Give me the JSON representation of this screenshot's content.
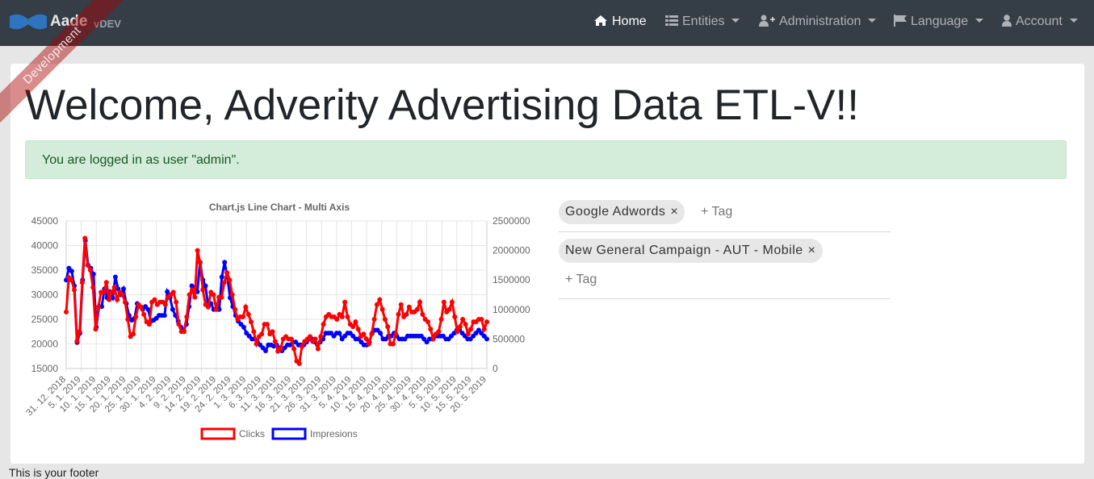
{
  "navbar": {
    "brand": "Aade",
    "version": "vDEV",
    "ribbon": "Development",
    "items": [
      {
        "label": "Home",
        "icon": "home-icon",
        "active": true
      },
      {
        "label": "Entities",
        "icon": "list-icon",
        "dropdown": true
      },
      {
        "label": "Administration",
        "icon": "user-plus-icon",
        "dropdown": true
      },
      {
        "label": "Language",
        "icon": "flag-icon",
        "dropdown": true
      },
      {
        "label": "Account",
        "icon": "user-icon",
        "dropdown": true
      }
    ]
  },
  "main": {
    "title": "Welcome, Adverity Advertising Data ETL-V!!",
    "alert": "You are logged in as user \"admin\".",
    "footer": "This is your footer"
  },
  "tags": {
    "rows": [
      {
        "chips": [
          "Google Adwords"
        ],
        "add_label": "+ Tag"
      },
      {
        "chips": [
          "New General Campaign - AUT - Mobile"
        ],
        "add_label": "+ Tag"
      }
    ],
    "remove_glyph": "×"
  },
  "chart_data": {
    "type": "line",
    "title": "Chart.js Line Chart - Multi Axis",
    "x_ticks": [
      "31. 12. 2018",
      "5. 1. 2019",
      "10. 1. 2019",
      "15. 1. 2019",
      "20. 1. 2019",
      "25. 1. 2019",
      "30. 1. 2019",
      "4. 2. 2019",
      "9. 2. 2019",
      "14. 2. 2019",
      "19. 2. 2019",
      "24. 2. 2019",
      "1. 3. 2019",
      "6. 3. 2019",
      "11. 3. 2019",
      "16. 3. 2019",
      "21. 3. 2019",
      "26. 3. 2019",
      "31. 3. 2019",
      "5. 4. 2019",
      "10. 4. 2019",
      "15. 4. 2019",
      "20. 4. 2019",
      "25. 4. 2019",
      "30. 4. 2019",
      "5. 5. 2019",
      "10. 5. 2019",
      "15. 5. 2019",
      "20. 5. 2019"
    ],
    "y_left": {
      "min": 15000,
      "max": 45000,
      "ticks": [
        15000,
        20000,
        25000,
        30000,
        35000,
        40000,
        45000
      ]
    },
    "y_right": {
      "min": 0,
      "max": 2500000,
      "ticks": [
        0,
        500000,
        1000000,
        1500000,
        2000000,
        2500000
      ]
    },
    "grid": true,
    "legend_position": "bottom",
    "series": [
      {
        "name": "Clicks",
        "axis": "left",
        "color": "#ff0000",
        "values": [
          26500,
          33500,
          33000,
          31000,
          20500,
          22500,
          32500,
          41500,
          36000,
          35000,
          31500,
          23000,
          27500,
          30500,
          30500,
          32500,
          29000,
          30500,
          31500,
          29000,
          30500,
          30000,
          28500,
          25000,
          21500,
          22000,
          25500,
          28000,
          27500,
          26000,
          24500,
          24000,
          28500,
          29000,
          28000,
          28500,
          28500,
          28000,
          29500,
          30000,
          30500,
          28500,
          24000,
          22500,
          22500,
          25500,
          30000,
          31000,
          29500,
          39000,
          36500,
          31000,
          28000,
          27500,
          30500,
          30000,
          27000,
          29500,
          29500,
          32500,
          34500,
          33000,
          30000,
          27000,
          25000,
          25500,
          25500,
          27500,
          26000,
          24500,
          22500,
          20000,
          21500,
          22000,
          24000,
          24000,
          22000,
          22500,
          20500,
          18500,
          19000,
          21000,
          21500,
          21000,
          21000,
          19000,
          16500,
          16000,
          19500,
          20500,
          21000,
          21500,
          20500,
          21000,
          19000,
          21500,
          24000,
          25500,
          26000,
          25500,
          25500,
          25000,
          26000,
          25500,
          28500,
          25500,
          24000,
          23500,
          24500,
          23000,
          21500,
          22000,
          21000,
          20000,
          22000,
          25000,
          28000,
          29000,
          27000,
          25000,
          23500,
          20000,
          20000,
          22000,
          26000,
          28000,
          25500,
          26000,
          27500,
          26500,
          26500,
          27000,
          28500,
          26000,
          25000,
          24500,
          23000,
          21000,
          22000,
          22500,
          25000,
          28500,
          26500,
          27000,
          28500,
          25500,
          22500,
          23500,
          25000,
          24000,
          22000,
          23000,
          24500,
          24500,
          25000,
          25000,
          23000,
          24500
        ],
        "points": "markers"
      },
      {
        "name": "Impresions",
        "axis": "right",
        "color": "#0000ff",
        "values": [
          1500000,
          1700000,
          1650000,
          1400000,
          440000,
          600000,
          1500000,
          2170000,
          1750000,
          1700000,
          1600000,
          700000,
          1050000,
          1050000,
          1350000,
          1200000,
          1300000,
          1200000,
          1550000,
          1350000,
          1250000,
          1350000,
          1100000,
          900000,
          820000,
          850000,
          1100000,
          1050000,
          1000000,
          1050000,
          1000000,
          800000,
          820000,
          850000,
          900000,
          900000,
          900000,
          1300000,
          1200000,
          1000000,
          900000,
          800000,
          700000,
          650000,
          750000,
          1050000,
          1400000,
          1350000,
          1300000,
          1800000,
          1500000,
          1400000,
          1050000,
          1100000,
          1000000,
          1000000,
          1000000,
          1550000,
          1800000,
          1550000,
          1200000,
          1050000,
          900000,
          800000,
          750000,
          700000,
          600000,
          550000,
          500000,
          500000,
          450000,
          400000,
          350000,
          300000,
          400000,
          400000,
          380000,
          400000,
          350000,
          300000,
          350000,
          400000,
          400000,
          450000,
          450000,
          400000,
          400000,
          400000,
          450000,
          500000,
          500000,
          450000,
          400000,
          450000,
          500000,
          600000,
          600000,
          600000,
          550000,
          600000,
          600000,
          500000,
          550000,
          600000,
          600000,
          550000,
          500000,
          500000,
          450000,
          400000,
          400000,
          450000,
          600000,
          650000,
          650000,
          600000,
          500000,
          500000,
          550000,
          550000,
          600000,
          550000,
          500000,
          500000,
          500000,
          550000,
          550000,
          550000,
          550000,
          550000,
          550000,
          500000,
          450000,
          500000,
          500000,
          550000,
          550000,
          550000,
          550000,
          500000,
          500000,
          550000,
          600000,
          650000,
          650000,
          600000,
          550000,
          500000,
          500000,
          550000,
          600000,
          650000,
          600000,
          550000,
          500000
        ],
        "points": "markers"
      }
    ]
  }
}
